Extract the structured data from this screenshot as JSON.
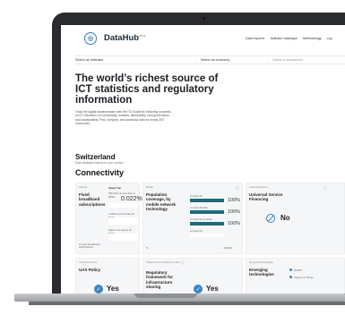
{
  "app": {
    "brand": "DataHub",
    "brand_mark": "beta"
  },
  "nav": [
    "Data explorer",
    "Indicator catalogue",
    "Methodology",
    "Log"
  ],
  "selectors": {
    "indicator_placeholder": "Select an indicator",
    "economy_placeholder": "Select an economy",
    "comparison_placeholder": "Select a comparison",
    "arrow": "→"
  },
  "hero": {
    "title": "The world’s richest source of ICT statistics and regulatory information",
    "description": "Track the digital transformation with the ITU DataHub, featuring hundreds of ICT indicators on connectivity, markets, affordability, trust governance, and sustainability. Find, compare, and download data for nearly 200 economies."
  },
  "country": {
    "name": "Switzerland",
    "subtitle": "Data displayed based on your location"
  },
  "section_title": "Connectivity",
  "cards": {
    "fixed_broadband": {
      "category": "Internet",
      "title": "Fixed broadband subscriptions",
      "speed_label": "Speed Tier",
      "row1": "256 kbit/s to less than 2 Mbit/s",
      "row1_value": "0.022%",
      "row2": "2 Mbit/s to less than 10 Mbit/s",
      "row3": "Equal to or above 10 Mbit/s",
      "footer": "% fixed broadband subscriptions"
    },
    "population_coverage": {
      "category": "Mobile",
      "title": "Population coverage, by mobile network technology",
      "rows": [
        {
          "label": "At least 3G",
          "value": "100%",
          "fill": 1.0
        },
        {
          "label": "At least 4G/LTE",
          "value": "100%",
          "fill": 1.0
        },
        {
          "label": "At least 5G (mobile)",
          "value": "100%",
          "fill": 1.0
        },
        {
          "label": "At least 5G",
          "value": "",
          "fill": 0.0
        }
      ],
      "footer_left": "%",
      "footer_right": "↑ MORE"
    },
    "universal_service": {
      "category": "Universal access",
      "title": "Universal Service Financing",
      "answer": "No"
    },
    "uas_policy": {
      "category": "Universal access",
      "title": "UAS Policy"
    },
    "regulatory_framework": {
      "category": "Infrastructure development and ...",
      "title": "Regulatory framework for infrastructure sharing",
      "answer": "Yes"
    },
    "uas_answer": "Yes",
    "emerging_tech": {
      "category": "Emerging technologies",
      "title": "Emerging technologies",
      "items": [
        "5G/IMT",
        "Internet of Things"
      ]
    }
  }
}
